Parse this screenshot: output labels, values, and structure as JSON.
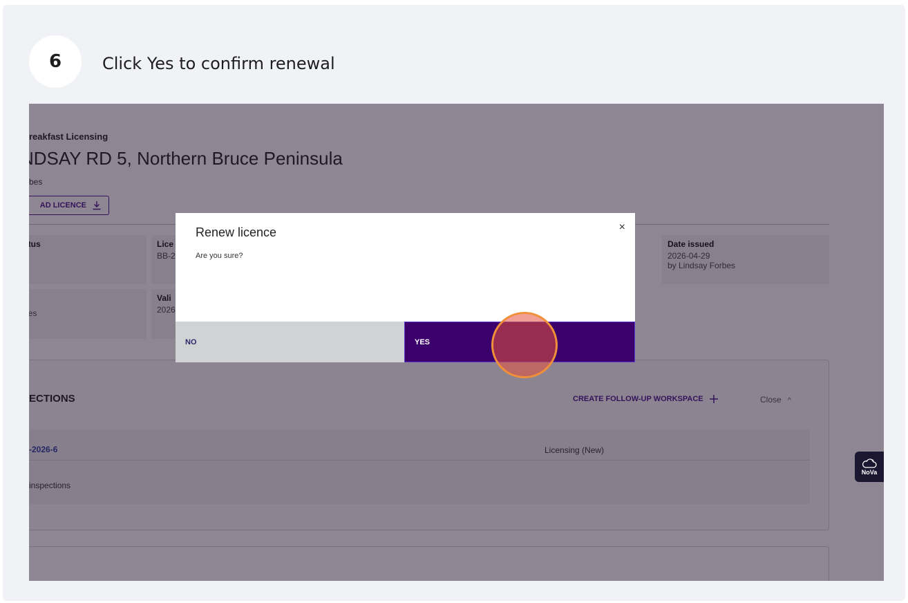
{
  "step": {
    "number": "6",
    "title": "Click Yes to confirm renewal"
  },
  "page": {
    "subtitle": "reakfast Licensing",
    "address": "NDSAY RD 5, Northern Bruce Peninsula",
    "owner": "bes",
    "download_label": "AD LICENCE",
    "fields": {
      "status_label": "tatus",
      "licence_label": "Lice",
      "licence_value": "BB-2",
      "issued_label": "Date issued",
      "issued_value": "2026-04-29",
      "issued_by": "by Lindsay Forbes",
      "holder_value": "rbes",
      "valid_label": "Vali",
      "valid_value": "2026"
    },
    "inspections": {
      "title": "ECTIONS",
      "create_label": "CREATE FOLLOW-UP WORKSPACE",
      "close_label": "Close",
      "row_id": "-2026-6",
      "row_type": "Licensing (New)",
      "row_inspections": "inspections"
    }
  },
  "nova_label": "NoVa",
  "modal": {
    "title": "Renew licence",
    "close_symbol": "×",
    "body": "Are you sure?",
    "no_label": "NO",
    "yes_label": "YES"
  }
}
